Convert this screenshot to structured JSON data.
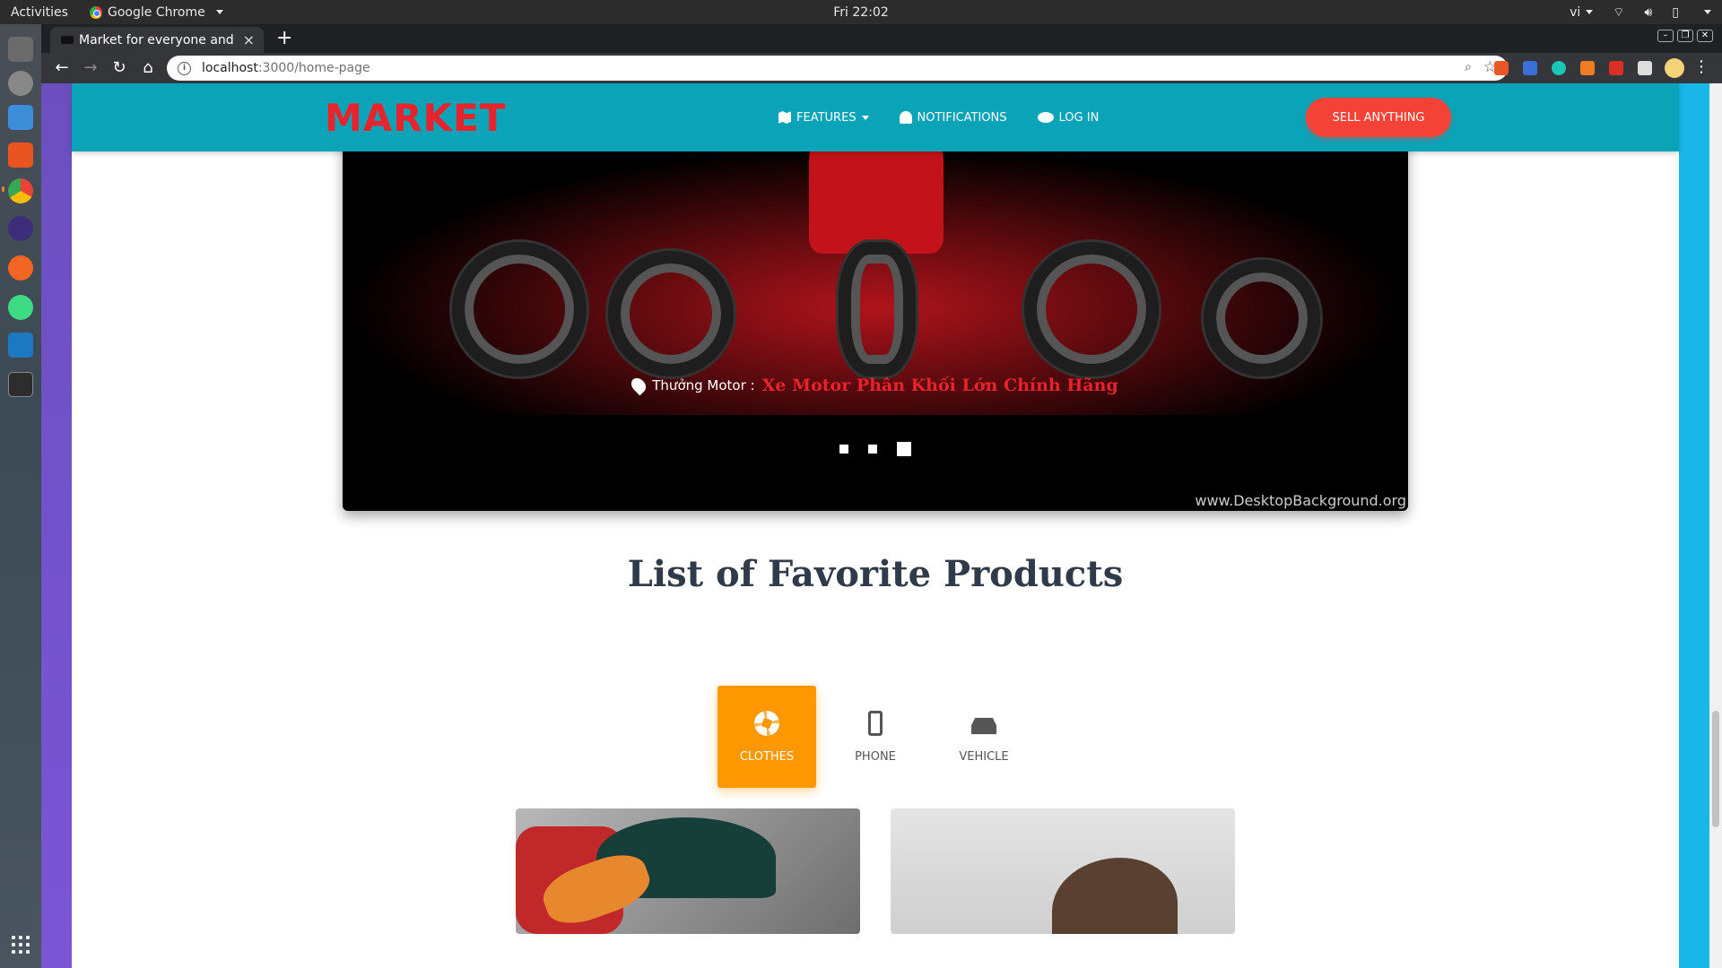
{
  "os": {
    "activities": "Activities",
    "app_name": "Google Chrome",
    "clock": "Fri 22:02",
    "lang": "vi"
  },
  "browser": {
    "tab_title": "Market for everyone and e",
    "url_host": "localhost",
    "url_path": ":3000/home-page"
  },
  "site": {
    "logo": "MARKET",
    "nav": {
      "features": "FEATURES",
      "notifications": "NOTIFICATIONS",
      "login": "LOG IN",
      "sell": "SELL ANYTHING"
    },
    "colors": {
      "navbar": "#0aa3b8",
      "logo": "#e8232b",
      "sell_button": "#f44336",
      "active_tab": "#ff9800"
    },
    "carousel": {
      "location_label": "Thưởng Motor :",
      "product_name": "Xe Motor Phân Khối Lớn Chính Hãng",
      "watermark": "www.DesktopBackground.org",
      "slide_count": 3,
      "active_slide": 3
    },
    "section_title": "List of Favorite Products",
    "categories": [
      {
        "label": "CLOTHES",
        "icon": "aperture-icon",
        "active": true
      },
      {
        "label": "PHONE",
        "icon": "phone-vibrate-icon",
        "active": false
      },
      {
        "label": "VEHICLE",
        "icon": "car-icon",
        "active": false
      }
    ]
  }
}
